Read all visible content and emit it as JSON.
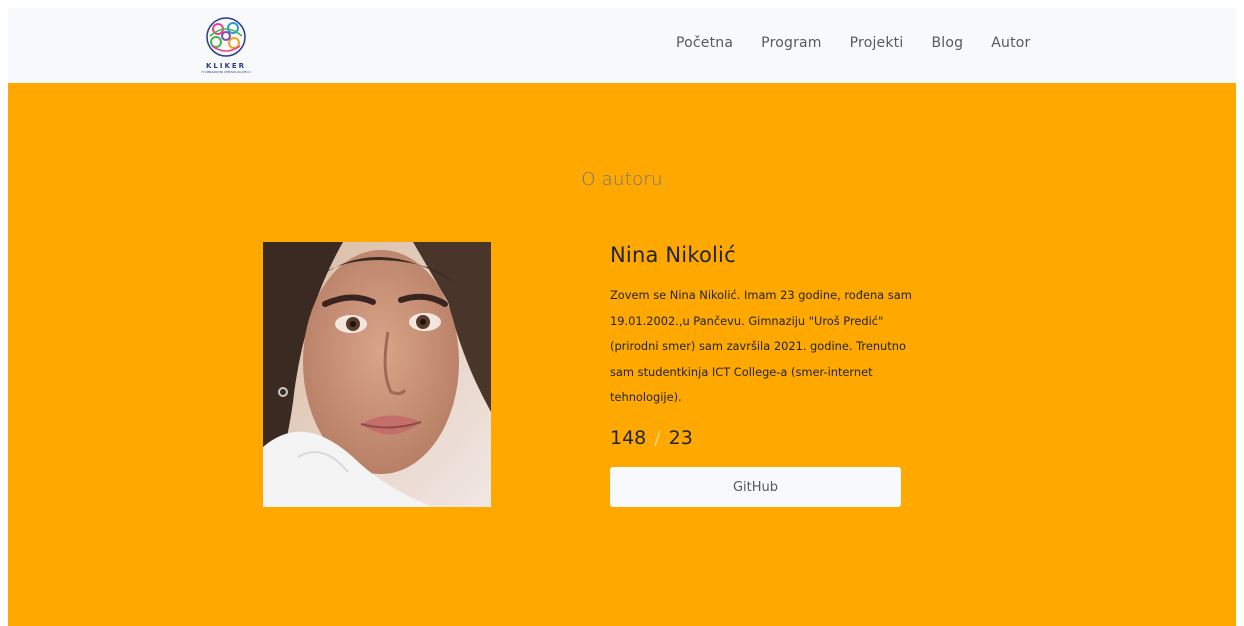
{
  "brand": {
    "name": "KLIKER",
    "tagline": "IT OBRAZOVNI CENTAR ZA DECU"
  },
  "nav": {
    "items": [
      "Početna",
      "Program",
      "Projekti",
      "Blog",
      "Autor"
    ]
  },
  "about": {
    "section_title": "O autoru",
    "name": "Nina Nikolić",
    "bio": "Zovem se Nina Nikolić. Imam 23 godine, rođena sam 19.01.2002.,u Pančevu. Gimnaziju \"Uroš Predić\" (prirodni smer) sam završila 2021. godine. Trenutno sam studentkinja ICT College-a (smer-internet tehnologije).",
    "stat_a": "148",
    "stat_separator": "/",
    "stat_b": "23",
    "github_label": "GitHub"
  },
  "colors": {
    "navbar_bg": "#f8f9fa",
    "hero_bg": "#ffa800",
    "accent_separator": "#ffd27a"
  }
}
